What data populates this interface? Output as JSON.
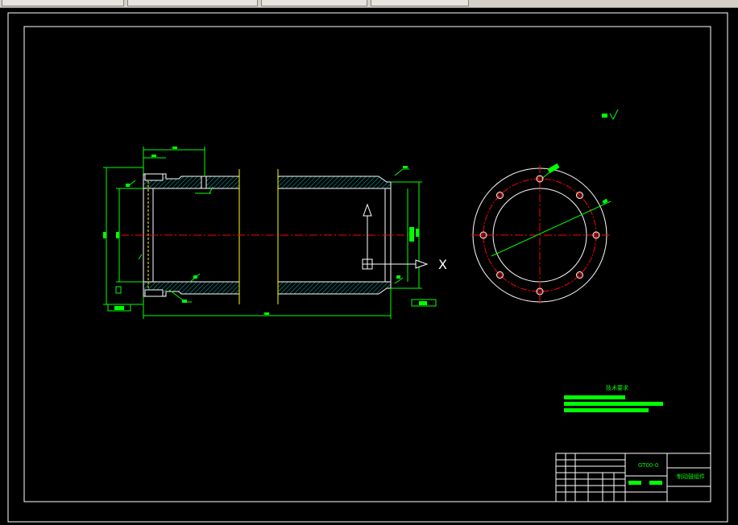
{
  "window": {
    "tabs": [
      "",
      "",
      "",
      ""
    ]
  },
  "drawing": {
    "colors": {
      "background": "#000000",
      "frame": "#ffffff",
      "dimension": "#00ff00",
      "centerline": "#ff0000",
      "hatch": "#00c0c0",
      "hidden": "#ffff00"
    },
    "notes": {
      "title": "技术要求"
    },
    "title_block": {
      "drawing_number": "GT00-0",
      "part_name": "制动鼓组件"
    },
    "axis_label": "X"
  }
}
